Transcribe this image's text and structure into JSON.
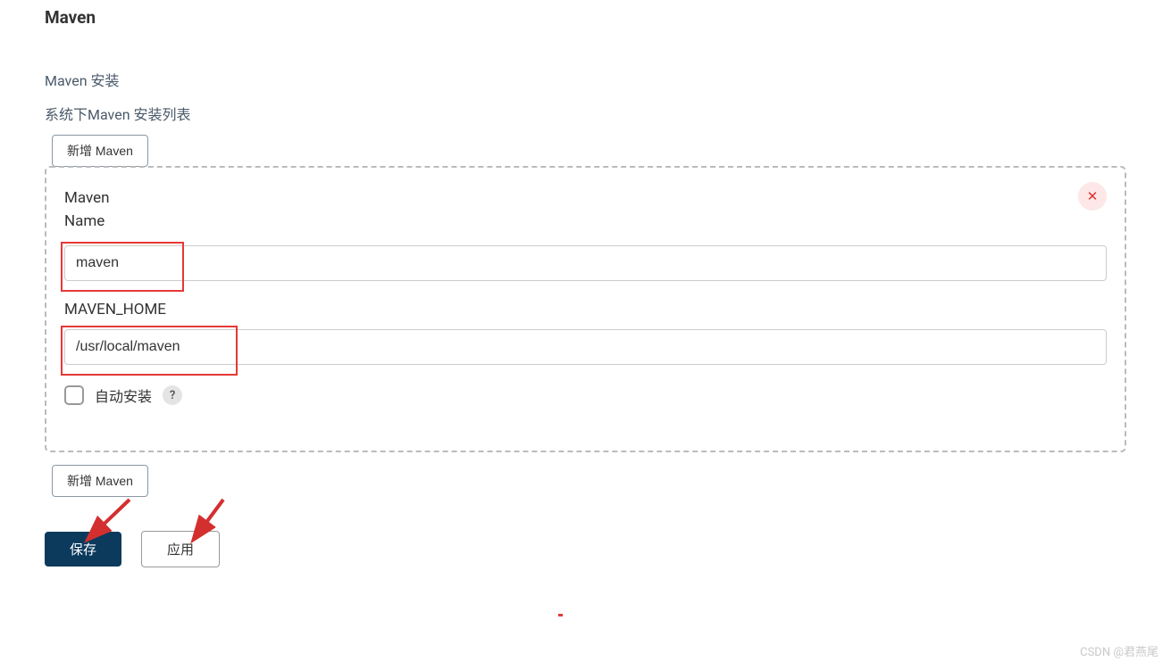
{
  "section": {
    "title": "Maven",
    "installTitle": "Maven 安装",
    "installListDesc": "系统下Maven 安装列表",
    "addButtonLabel": "新增 Maven"
  },
  "entry": {
    "headerLine1": "Maven",
    "headerLine2": "Name",
    "nameValue": "maven",
    "mavenHomeLabel": "MAVEN_HOME",
    "mavenHomeValue": "/usr/local/maven",
    "autoInstallLabel": "自动安装",
    "helpSymbol": "?",
    "closeSymbol": "✕"
  },
  "footer": {
    "saveLabel": "保存",
    "applyLabel": "应用"
  },
  "watermark": "CSDN @君燕尾"
}
